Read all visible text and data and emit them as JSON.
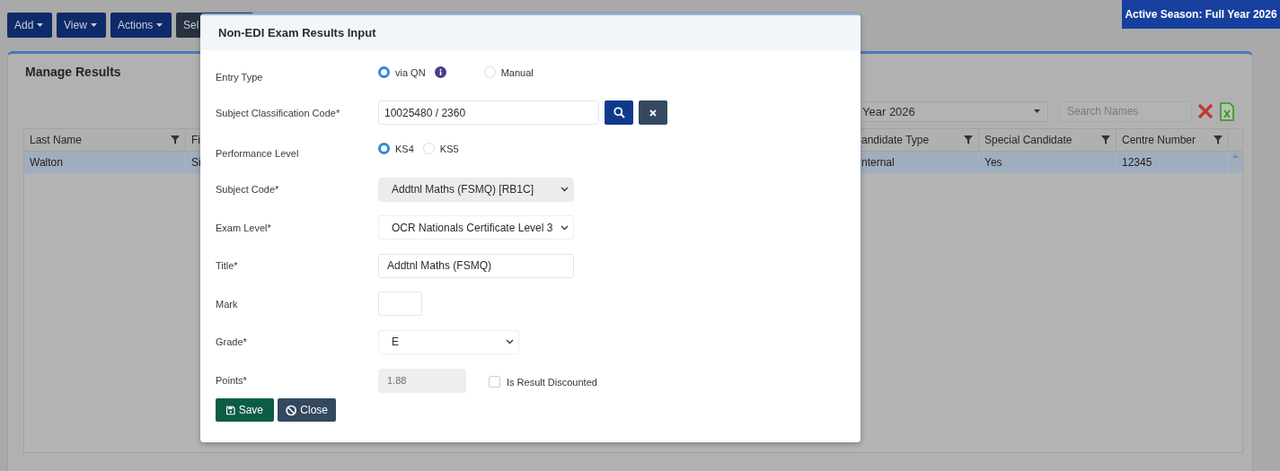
{
  "toolbar": {
    "buttons": [
      {
        "label": "Add",
        "caret": true
      },
      {
        "label": "View",
        "caret": true
      },
      {
        "label": "Actions",
        "caret": true
      },
      {
        "label": "Sel",
        "caret": false
      }
    ]
  },
  "season_badge": "Active Season: Full Year 2026",
  "panel": {
    "title": "Manage Results",
    "season_select": "Year 2026",
    "search": {
      "placeholder": "Search Names"
    },
    "table": {
      "columns": [
        {
          "label": "Last Name",
          "filter": true
        },
        {
          "label": "Fi",
          "filter": false
        },
        {
          "label": "andidate Type",
          "filter": true
        },
        {
          "label": "Special Candidate",
          "filter": true
        },
        {
          "label": "Centre Number",
          "filter": true
        }
      ],
      "rows": [
        {
          "selected": true,
          "cells": [
            "Walton",
            "Si",
            "nternal",
            "Yes",
            "12345"
          ]
        }
      ]
    }
  },
  "dialog": {
    "title": "Non-EDI Exam Results Input",
    "fields": [
      {
        "kind": "radio",
        "label": "Entry Type",
        "options": [
          {
            "label": "via QN",
            "selected": true,
            "info": true
          },
          {
            "label": "Manual",
            "selected": false,
            "info": false
          }
        ]
      },
      {
        "kind": "lookup",
        "label": "Subject Classification Code*",
        "value": "10025480 / 2360"
      },
      {
        "kind": "radio",
        "label": "Performance Level",
        "options": [
          {
            "label": "KS4",
            "selected": true,
            "info": false
          },
          {
            "label": "KS5",
            "selected": false,
            "info": false
          }
        ]
      },
      {
        "kind": "select",
        "label": "Subject Code*",
        "value": "Addtnl Maths (FSMQ) [RB1C]",
        "disabled": true
      },
      {
        "kind": "select",
        "label": "Exam Level*",
        "value": "OCR Nationals Certificate Level 3",
        "disabled": false
      },
      {
        "kind": "text",
        "label": "Title*",
        "value": "Addtnl Maths (FSMQ)",
        "disabled": false
      },
      {
        "kind": "text",
        "label": "Mark",
        "disabled": false
      },
      {
        "kind": "select",
        "label": "Grade*",
        "value": "E",
        "disabled": false
      },
      {
        "kind": "points",
        "label": "Points*",
        "value": "1.88",
        "disabled": true,
        "checkbox": {
          "label": "Is Result Discounted",
          "checked": false
        }
      }
    ],
    "buttons": [
      {
        "kind": "save",
        "label": "Save"
      },
      {
        "kind": "close",
        "label": "Close"
      }
    ]
  }
}
